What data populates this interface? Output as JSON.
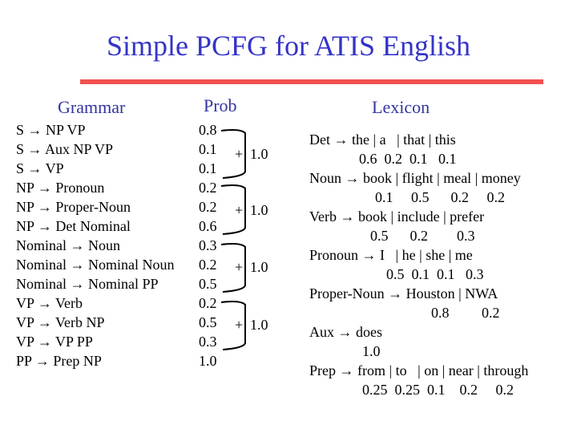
{
  "title": "Simple PCFG for ATIS English",
  "headers": {
    "grammar": "Grammar",
    "prob": "Prob",
    "lexicon": "Lexicon"
  },
  "colors": {
    "title": "#3434c8",
    "divider": "#f25050",
    "header": "#3434a0"
  },
  "grammar": [
    {
      "rule": "S → NP VP",
      "prob": "0.8"
    },
    {
      "rule": "S → Aux NP VP",
      "prob": "0.1"
    },
    {
      "rule": "S → VP",
      "prob": "0.1"
    },
    {
      "rule": "NP → Pronoun",
      "prob": "0.2"
    },
    {
      "rule": "NP → Proper-Noun",
      "prob": "0.2"
    },
    {
      "rule": "NP → Det Nominal",
      "prob": "0.6"
    },
    {
      "rule": "Nominal → Noun",
      "prob": "0.3"
    },
    {
      "rule": "Nominal → Nominal Noun",
      "prob": "0.2"
    },
    {
      "rule": "Nominal → Nominal PP",
      "prob": "0.5"
    },
    {
      "rule": "VP → Verb",
      "prob": "0.2"
    },
    {
      "rule": "VP → Verb NP",
      "prob": "0.5"
    },
    {
      "rule": "VP → VP PP",
      "prob": "0.3"
    },
    {
      "rule": "PP → Prep NP",
      "prob": "1.0"
    }
  ],
  "groups": [
    {
      "plus": "+",
      "sum": "1.0"
    },
    {
      "plus": "+",
      "sum": "1.0"
    },
    {
      "plus": "+",
      "sum": "1.0"
    },
    {
      "plus": "+",
      "sum": "1.0"
    }
  ],
  "lexicon": [
    {
      "rule": "Det → the | a   | that | this",
      "probs": "0.6  0.2  0.1   0.1"
    },
    {
      "rule": "Noun → book | flight | meal | money",
      "probs": "0.1     0.5      0.2     0.2"
    },
    {
      "rule": "Verb → book | include | prefer",
      "probs": "0.5      0.2        0.3"
    },
    {
      "rule": "Pronoun → I   | he | she | me",
      "probs": "0.5  0.1  0.1   0.3"
    },
    {
      "rule": "Proper-Noun → Houston | NWA",
      "probs": "0.8         0.2"
    },
    {
      "rule": "Aux → does",
      "probs": "1.0"
    },
    {
      "rule": "Prep → from | to   | on | near | through",
      "probs": "0.25  0.25  0.1    0.2     0.2"
    }
  ]
}
